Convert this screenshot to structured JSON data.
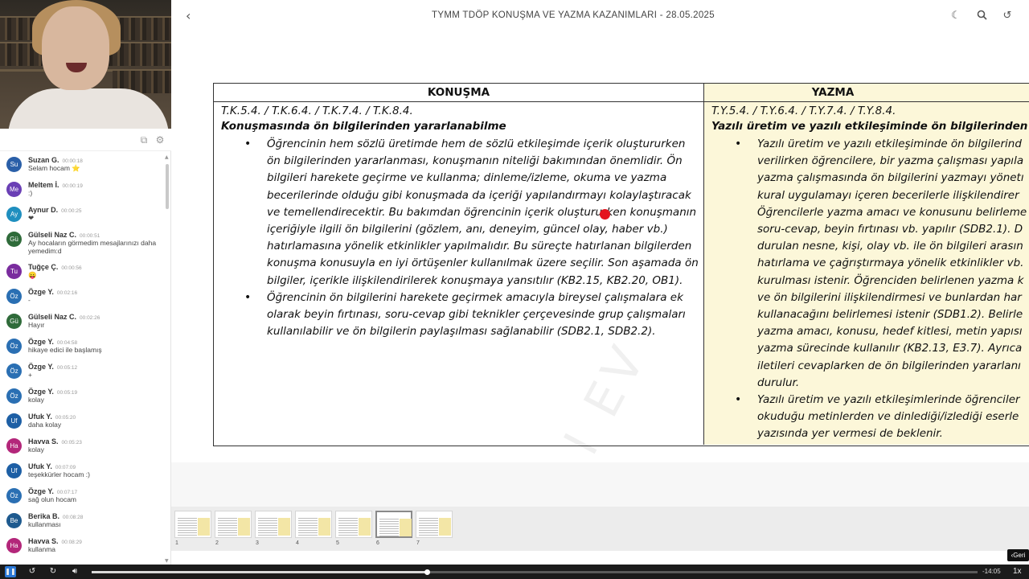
{
  "topbar": {
    "title": "TYMM TDÖP KONUŞMA VE YAZMA KAZANIMLARI - 28.05.2025"
  },
  "chat": {
    "messages": [
      {
        "initials": "Su",
        "color": "#2a5fa8",
        "name": "Suzan G.",
        "time": "00:00:18",
        "text": "Selam hocam ⭐"
      },
      {
        "initials": "Me",
        "color": "#6a3fb5",
        "name": "Meltem İ.",
        "time": "00:00:19",
        "text": ":)"
      },
      {
        "initials": "Ay",
        "color": "#1f8fbf",
        "name": "Aynur D.",
        "time": "00:00:25",
        "text": "❤"
      },
      {
        "initials": "Gü",
        "color": "#2f6b3a",
        "name": "Gülseli Naz C.",
        "time": "00:00:51",
        "text": "Ay hocaların görmedim mesajlarınızı daha yemedim:d"
      },
      {
        "initials": "Tu",
        "color": "#7a2c9e",
        "name": "Tuğçe Ç.",
        "time": "00:00:56",
        "text": "😛"
      },
      {
        "initials": "Öz",
        "color": "#2a6fb3",
        "name": "Özge Y.",
        "time": "00:02:16",
        "text": "-"
      },
      {
        "initials": "Gü",
        "color": "#2f6b3a",
        "name": "Gülseli Naz C.",
        "time": "00:02:26",
        "text": "Hayır"
      },
      {
        "initials": "Öz",
        "color": "#2a6fb3",
        "name": "Özge Y.",
        "time": "00:04:58",
        "text": "hikaye edici ile başlamış"
      },
      {
        "initials": "Öz",
        "color": "#2a6fb3",
        "name": "Özge Y.",
        "time": "00:05:12",
        "text": "+"
      },
      {
        "initials": "Öz",
        "color": "#2a6fb3",
        "name": "Özge Y.",
        "time": "00:05:19",
        "text": "kolay"
      },
      {
        "initials": "Uf",
        "color": "#1d5fa5",
        "name": "Ufuk Y.",
        "time": "00:05:20",
        "text": "daha kolay"
      },
      {
        "initials": "Ha",
        "color": "#b3267a",
        "name": "Havva S.",
        "time": "00:05:23",
        "text": "kolay"
      },
      {
        "initials": "Uf",
        "color": "#1d5fa5",
        "name": "Ufuk Y.",
        "time": "00:07:09",
        "text": "teşekkürler hocam :)"
      },
      {
        "initials": "Öz",
        "color": "#2a6fb3",
        "name": "Özge Y.",
        "time": "00:07:17",
        "text": "sağ olun hocam"
      },
      {
        "initials": "Be",
        "color": "#1e5a8f",
        "name": "Berika B.",
        "time": "00:08:28",
        "text": "kullanması"
      },
      {
        "initials": "Ha",
        "color": "#b3267a",
        "name": "Havva S.",
        "time": "00:08:29",
        "text": "kullanma"
      }
    ]
  },
  "slide": {
    "left": {
      "header": "KONUŞMA",
      "codes": "T.K.5.4. / T.K.6.4. / T.K.7.4. / T.K.8.4.",
      "heading": "Konuşmasında ön bilgilerinden yararlanabilme",
      "bullets": [
        "Öğrencinin hem sözlü üretimde hem de sözlü etkileşimde içerik oluştururken ön bilgilerinden yararlanması, konuşmanın niteliği bakımından önemlidir. Ön bilgileri harekete geçirme ve kullanma; dinleme/izleme, okuma ve yazma becerilerinde olduğu gibi konuşmada da içeriği yapılandırmayı kolaylaştıracak ve temellendirecektir. Bu bakımdan öğrencinin içerik oluştururken konuşmanın içeriğiyle ilgili ön bilgilerini (gözlem, anı, deneyim, güncel olay, haber vb.) hatırlamasına yönelik etkinlikler yapılmalıdır. Bu süreçte hatırlanan bilgilerden konuşma konusuyla en iyi örtüşenler kullanılmak üzere seçilir. Son aşamada ön bilgiler, içerikle ilişkilendirilerek konuşmaya yansıtılır (KB2.15, KB2.20, OB1).",
        "Öğrencinin ön bilgilerini harekete geçirmek amacıyla bireysel çalışmalara ek olarak beyin fırtınası, soru-cevap gibi teknikler çerçevesinde grup çalışmaları kullanılabilir ve ön bilgilerin paylaşılması sağlanabilir (SDB2.1, SDB2.2)."
      ]
    },
    "right": {
      "header": "YAZMA",
      "codes": "T.Y.5.4. / T.Y.6.4. / T.Y.7.4. / T.Y.8.4.",
      "heading": "Yazılı üretim ve yazılı etkileşiminde ön bilgilerinden yarar",
      "bullet1_lines": [
        "Yazılı üretim ve yazılı etkileşiminde ön bilgilerind",
        "verilirken öğrencilere, bir yazma çalışması yapıla",
        "yazma çalışmasında ön bilgilerini yazmayı yönetı",
        "kural uygulamayı içeren becerilerle ilişkilendirer",
        "Öğrencilerle yazma amacı ve konusunu belirleme",
        "soru-cevap, beyin fırtınası vb. yapılır (SDB2.1). D",
        "durulan nesne, kişi, olay vb. ile ön bilgileri arasın",
        "hatırlama ve çağrıştırmaya yönelik etkinlikler vb.",
        "kurulması istenir. Öğrenciden belirlenen yazma k",
        "ve ön bilgilerini ilişkilendirmesi ve bunlardan har",
        "kullanacağını belirlemesi istenir (SDB1.2). Belirle",
        "yazma amacı, konusu, hedef kitlesi, metin yapısı",
        "yazma sürecinde kullanılır (KB2.13, E3.7). Ayrıca",
        "iletileri cevaplarken de ön bilgilerinden yararlanı",
        "durulur."
      ],
      "bullet2_lines": [
        "Yazılı üretim ve yazılı etkileşimlerinde öğrenciler",
        "okuduğu metinlerden ve dinlediği/izlediği eserle",
        "yazısında yer vermesi de beklenir."
      ]
    }
  },
  "thumbnails": [
    {
      "num": "1"
    },
    {
      "num": "2"
    },
    {
      "num": "3"
    },
    {
      "num": "4"
    },
    {
      "num": "5"
    },
    {
      "num": "6"
    },
    {
      "num": "7"
    }
  ],
  "active_thumbnail": 6,
  "geri_label": "‹Geri",
  "player": {
    "progress": 0.378,
    "time_left": "-14:05",
    "speed": "1x"
  }
}
